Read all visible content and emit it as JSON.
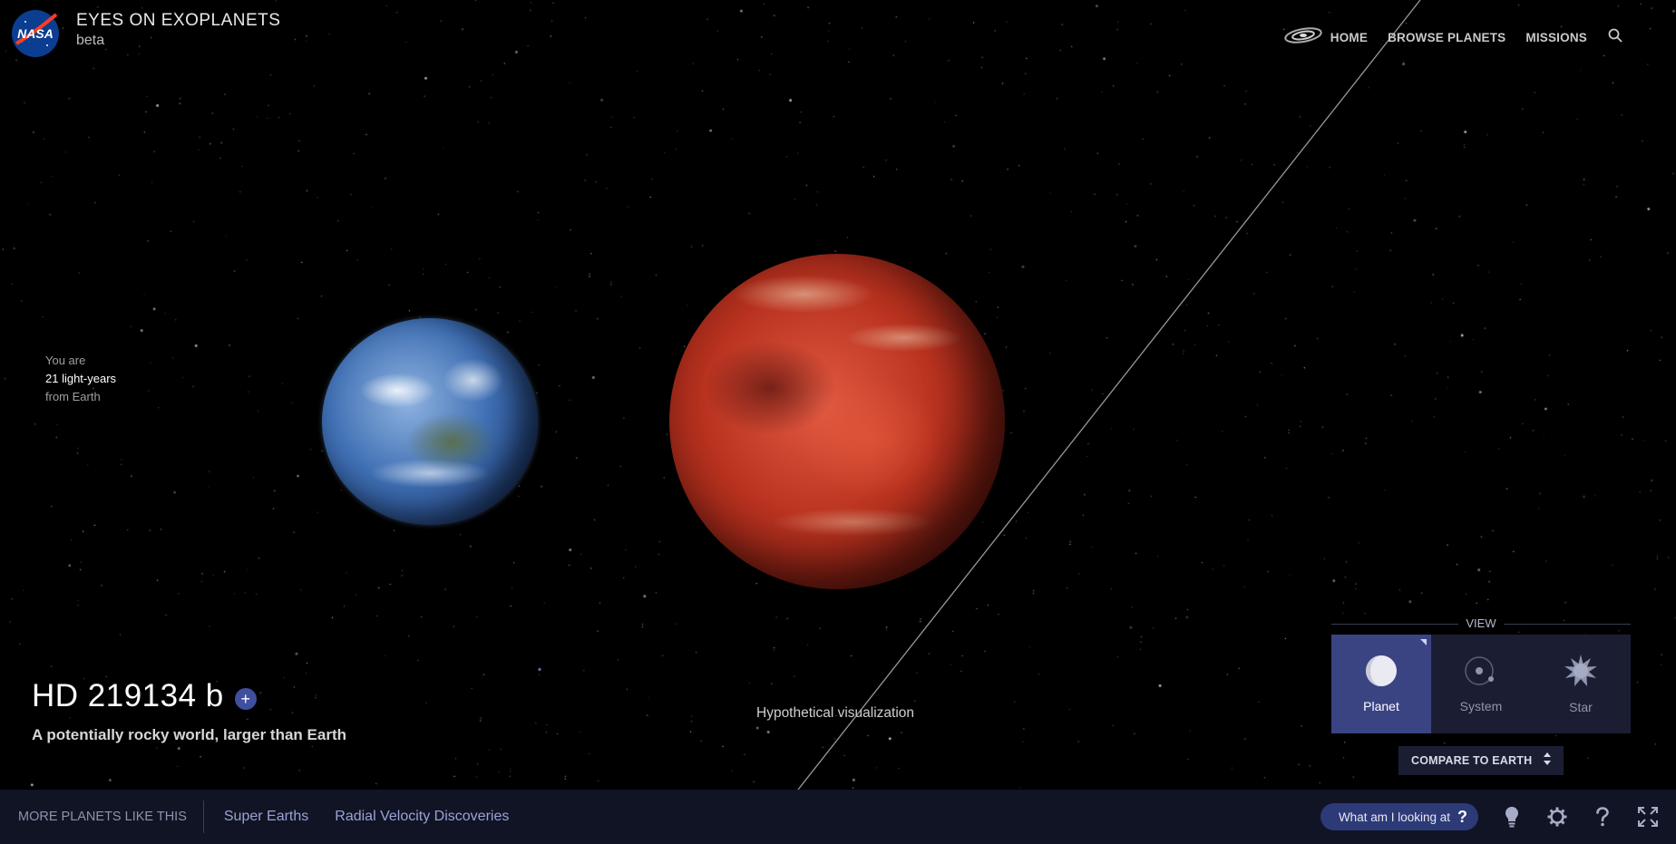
{
  "header": {
    "logo_text": "NASA",
    "title": "EYES ON EXOPLANETS",
    "subtitle": "beta",
    "nav": {
      "home": "HOME",
      "browse": "BROWSE PLANETS",
      "missions": "MISSIONS"
    }
  },
  "distance": {
    "prefix": "You are",
    "value": "21 light-years",
    "suffix": "from Earth"
  },
  "planet": {
    "name": "HD 219134 b",
    "tagline": "A potentially rocky world, larger than Earth",
    "add_symbol": "+"
  },
  "visualization_note": "Hypothetical visualization",
  "view": {
    "label": "VIEW",
    "options": [
      {
        "label": "Planet",
        "active": true
      },
      {
        "label": "System",
        "active": false
      },
      {
        "label": "Star",
        "active": false
      }
    ],
    "compare_label": "COMPARE TO EARTH"
  },
  "bottom": {
    "more_label": "MORE PLANETS LIKE THIS",
    "categories": [
      "Super Earths",
      "Radial Velocity Discoveries"
    ],
    "what_label": "What am I looking at",
    "what_icon": "?"
  },
  "colors": {
    "accent": "#3a4483",
    "panel": "#1b1e33",
    "bar": "#111425",
    "link": "#9aa3d4"
  },
  "icons": [
    "nasa-logo",
    "galaxy-icon",
    "search-icon",
    "planet-icon",
    "system-icon",
    "star-icon",
    "updown-icon",
    "lightbulb-icon",
    "gear-icon",
    "help-icon",
    "fullscreen-icon"
  ]
}
